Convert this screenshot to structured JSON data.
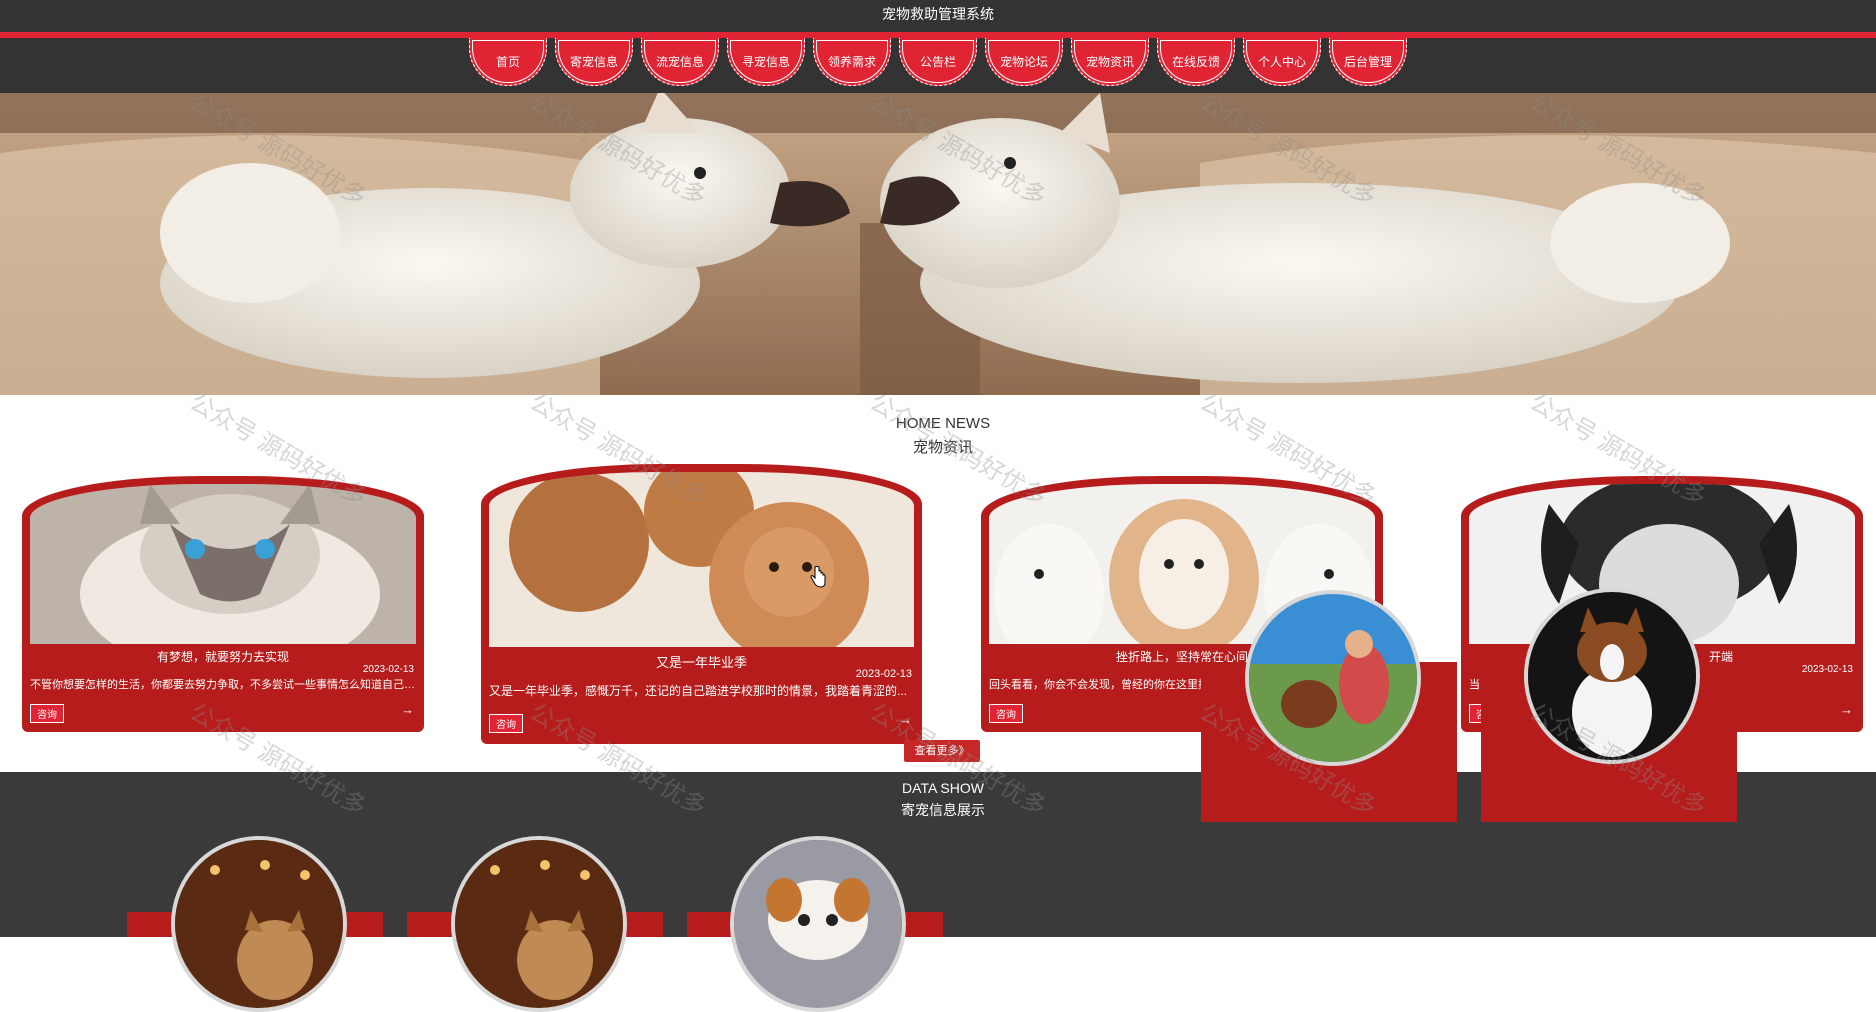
{
  "header": {
    "title": "宠物救助管理系统"
  },
  "nav": {
    "items": [
      {
        "label": "首页"
      },
      {
        "label": "寄宠信息"
      },
      {
        "label": "流宠信息"
      },
      {
        "label": "寻宠信息"
      },
      {
        "label": "领养需求"
      },
      {
        "label": "公告栏"
      },
      {
        "label": "宠物论坛"
      },
      {
        "label": "宠物资讯"
      },
      {
        "label": "在线反馈"
      },
      {
        "label": "个人中心"
      },
      {
        "label": "后台管理"
      }
    ]
  },
  "banner": {
    "slides": 3,
    "active_slide": 3
  },
  "news": {
    "title_en": "HOME NEWS",
    "title_cn": "宠物资讯",
    "cards": [
      {
        "title": "有梦想，就要努力去实现",
        "date": "2023-02-13",
        "desc": "不管你想要怎样的生活，你都要去努力争取，不多尝试一些事情怎么知道自己适...",
        "button": "咨询",
        "arrow": "→"
      },
      {
        "title": "又是一年毕业季",
        "date": "2023-02-13",
        "desc": "又是一年毕业季，感慨万千，还记的自己踏进学校那时的情景，我踏着青涩的...",
        "button": "咨询",
        "arrow": "→"
      },
      {
        "title": "挫折路上，坚持常在心间",
        "date": "2023-02-13",
        "desc": "回头看看，你会不会发现，曾经的你在这里摔倒...",
        "button": "咨询",
        "arrow": "→"
      },
      {
        "title": "开端",
        "date": "2023-02-13",
        "desc": "当...们每个人成长的必经之...",
        "button": "咨",
        "arrow": "→"
      }
    ],
    "more_label": "查看更多》"
  },
  "data_show": {
    "title_en": "DATA SHOW",
    "title_cn": "寄宠信息展示"
  },
  "watermark": "公众号 源码好优多",
  "colors": {
    "accent": "#e02434",
    "card_red": "#b71c1c",
    "dark": "#333333"
  }
}
